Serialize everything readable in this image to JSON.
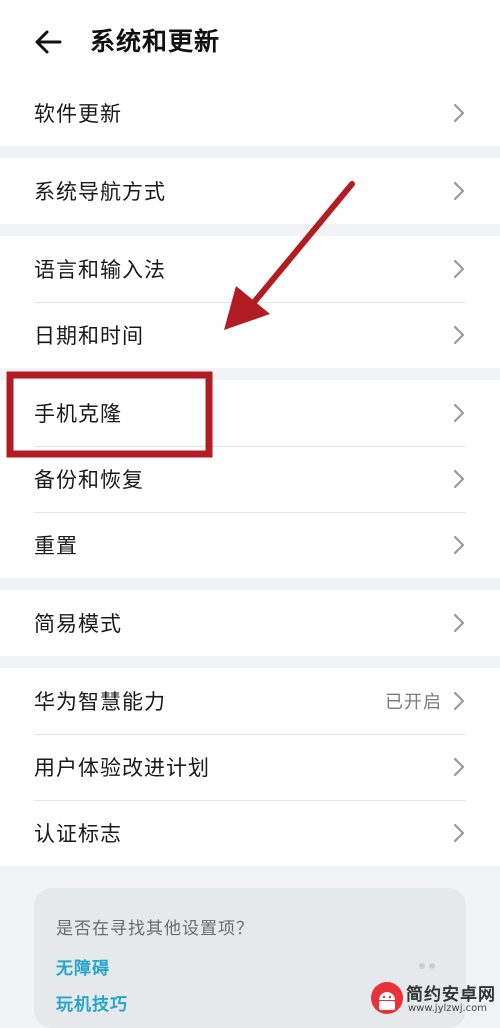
{
  "header": {
    "title": "系统和更新"
  },
  "groups": [
    {
      "items": [
        {
          "label": "软件更新"
        }
      ]
    },
    {
      "items": [
        {
          "label": "系统导航方式"
        }
      ]
    },
    {
      "items": [
        {
          "label": "语言和输入法"
        },
        {
          "label": "日期和时间"
        }
      ]
    },
    {
      "items": [
        {
          "label": "手机克隆"
        },
        {
          "label": "备份和恢复"
        },
        {
          "label": "重置"
        }
      ]
    },
    {
      "items": [
        {
          "label": "简易模式"
        }
      ]
    },
    {
      "items": [
        {
          "label": "华为智慧能力",
          "status": "已开启"
        },
        {
          "label": "用户体验改进计划"
        },
        {
          "label": "认证标志"
        }
      ]
    }
  ],
  "suggestions": {
    "title": "是否在寻找其他设置项？",
    "links": [
      "无障碍",
      "玩机技巧"
    ]
  },
  "watermark": {
    "text": "简约安卓网",
    "url": "www.jylzwj.com"
  },
  "annotation": {
    "highlight_target": "手机克隆",
    "color": "#b11d22"
  },
  "colors": {
    "link": "#27a6c9",
    "background": "#f1f3f5",
    "card": "#ffffff"
  }
}
